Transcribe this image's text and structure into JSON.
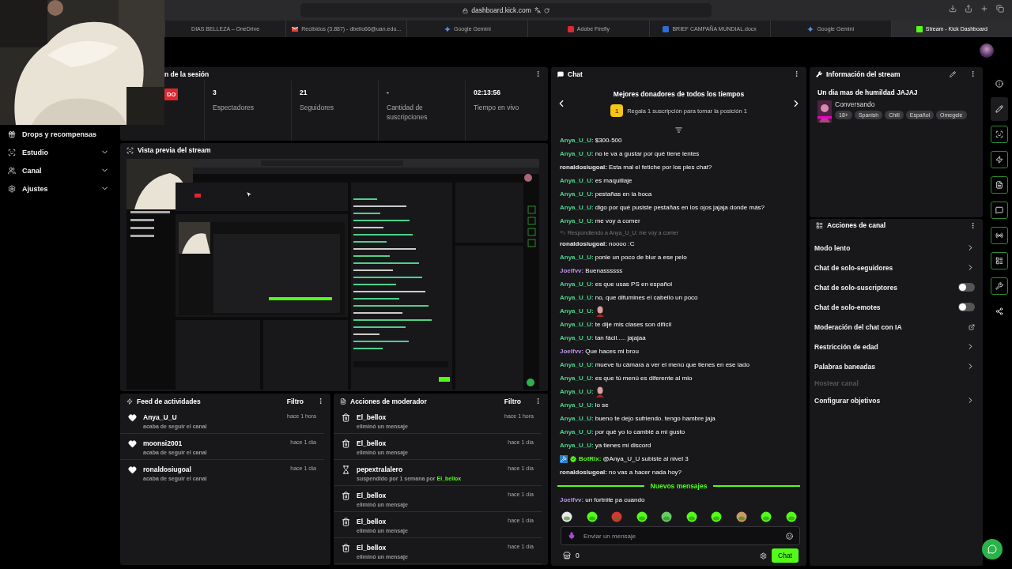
{
  "browser": {
    "address": "dashboard.kick.com",
    "tabs": [
      {
        "label": "DIAS BELLEZA – OneDrive",
        "kind": "none",
        "selected": false
      },
      {
        "label": "Recibidos (3.887) - dbello66@uan.edu...",
        "kind": "mail",
        "selected": false
      },
      {
        "label": "Google Gemini",
        "kind": "gemini",
        "selected": false
      },
      {
        "label": "Adobe Firefly",
        "kind": "firefly",
        "selected": false
      },
      {
        "label": "BRIEF CAMPAÑA MUNDIAL.docx",
        "kind": "word",
        "selected": false
      },
      {
        "label": "Google Gemini",
        "kind": "gemini",
        "selected": false
      },
      {
        "label": "Stream - Kick Dashboard",
        "kind": "kick",
        "selected": true
      }
    ]
  },
  "sidebar": {
    "items": [
      {
        "label": "Drops y recompensas",
        "kind": "drops",
        "expandable": false
      },
      {
        "label": "Estudio",
        "kind": "studio",
        "expandable": true
      },
      {
        "label": "Canal",
        "kind": "channel",
        "expandable": true
      },
      {
        "label": "Ajustes",
        "kind": "settings",
        "expandable": true
      }
    ]
  },
  "session": {
    "title": "n de la sesión",
    "live_badge": "DO",
    "stats": [
      {
        "value": "3",
        "label": "Espectadores"
      },
      {
        "value": "21",
        "label": "Seguidores"
      },
      {
        "value": "-",
        "label": "Cantidad de suscripciones"
      },
      {
        "value": "02:13:56",
        "label": "Tiempo en vivo"
      }
    ]
  },
  "preview": {
    "title": "Vista previa del stream"
  },
  "activity_feed": {
    "title": "Feed de actividades",
    "filter": "Filtro",
    "items": [
      {
        "user": "Anya_U_U",
        "action": "acaba de seguir el canal",
        "time": "hace 1 hora"
      },
      {
        "user": "moonsi2001",
        "action": "acaba de seguir el canal",
        "time": "hace 1 día"
      },
      {
        "user": "ronaldosiugoal",
        "action": "acaba de seguir el canal",
        "time": "hace 1 día"
      }
    ]
  },
  "mod_actions": {
    "title": "Acciones de moderador",
    "filter": "Filtro",
    "items": [
      {
        "kind": "delete",
        "user": "El_bellox",
        "action": "eliminó un mensaje",
        "time": "hace 1 hora"
      },
      {
        "kind": "delete",
        "user": "El_bellox",
        "action": "eliminó un mensaje",
        "time": "hace 1 día"
      },
      {
        "kind": "timeout",
        "user": "pepextralalero",
        "action": "suspendido por 1 semana por",
        "actor": "El_bellox",
        "time": "hace 1 día"
      },
      {
        "kind": "delete",
        "user": "El_bellox",
        "action": "eliminó un mensaje",
        "time": "hace 1 día"
      },
      {
        "kind": "delete",
        "user": "El_bellox",
        "action": "eliminó un mensaje",
        "time": "hace 1 día"
      },
      {
        "kind": "delete",
        "user": "El_bellox",
        "action": "eliminó un mensaje",
        "time": "hace 1 día"
      }
    ]
  },
  "chat": {
    "title": "Chat",
    "donors_title": "Mejores donadores de todos los tiempos",
    "donor_rank": "1",
    "donor_prompt": "Regala 1 suscripción para tomar la posición 1",
    "messages": [
      {
        "kind": "message",
        "user": "Anya_U_U:",
        "color": "#4fd18b",
        "text": "$300-500"
      },
      {
        "kind": "message",
        "user": "Anya_U_U:",
        "color": "#4fd18b",
        "text": "no le va a gustar por qué tiene lentes"
      },
      {
        "kind": "message",
        "user": "ronaldosiugoal:",
        "color": "#e8e8e8",
        "text": "Esta mal el fetiche por los pies chat?"
      },
      {
        "kind": "message",
        "user": "Anya_U_U:",
        "color": "#4fd18b",
        "text": "es maquillaje"
      },
      {
        "kind": "message",
        "user": "Anya_U_U:",
        "color": "#4fd18b",
        "text": "pestañas en la boca"
      },
      {
        "kind": "message",
        "user": "Anya_U_U:",
        "color": "#4fd18b",
        "text": "digo por qué pusiste pestañas en los ojos jajaja donde más?"
      },
      {
        "kind": "message",
        "user": "Anya_U_U:",
        "color": "#4fd18b",
        "text": "me voy a comer"
      },
      {
        "kind": "reply",
        "text": "Respondiendo a Anya_U_U: me voy a comer"
      },
      {
        "kind": "message",
        "user": "ronaldosiugoal:",
        "color": "#e8e8e8",
        "text": "noooo :C"
      },
      {
        "kind": "message",
        "user": "Anya_U_U:",
        "color": "#4fd18b",
        "text": "ponle un poco de blur a ese pelo"
      },
      {
        "kind": "message",
        "user": "Joelfvv:",
        "color": "#b894e6",
        "text": "Buenassssss"
      },
      {
        "kind": "message",
        "user": "Anya_U_U:",
        "color": "#4fd18b",
        "text": "es que usas PS en español"
      },
      {
        "kind": "message",
        "user": "Anya_U_U:",
        "color": "#4fd18b",
        "text": "no, que difumines el cabello un poco"
      },
      {
        "kind": "emote",
        "user": "Anya_U_U:",
        "color": "#4fd18b"
      },
      {
        "kind": "message",
        "user": "Anya_U_U:",
        "color": "#4fd18b",
        "text": "te dije mis clases son difícil"
      },
      {
        "kind": "message",
        "user": "Anya_U_U:",
        "color": "#4fd18b",
        "text": "tan fácil..... jajajaa"
      },
      {
        "kind": "message",
        "user": "Joelfvv:",
        "color": "#b894e6",
        "text": "Que haces mi brou"
      },
      {
        "kind": "message",
        "user": "Anya_U_U:",
        "color": "#4fd18b",
        "text": "mueve tu cámara a ver el menú que tienes en ese lado"
      },
      {
        "kind": "message",
        "user": "Anya_U_U:",
        "color": "#4fd18b",
        "text": "es que tú menú es diferente al mio"
      },
      {
        "kind": "emote",
        "user": "Anya_U_U:",
        "color": "#4fd18b"
      },
      {
        "kind": "message",
        "user": "Anya_U_U:",
        "color": "#4fd18b",
        "text": "lo se"
      },
      {
        "kind": "message",
        "user": "Anya_U_U:",
        "color": "#4fd18b",
        "text": "bueno te dejo sufriendo. tengo hambre jaja"
      },
      {
        "kind": "message",
        "user": "Anya_U_U:",
        "color": "#4fd18b",
        "text": "por qué yo lo cambié a mi gusto"
      },
      {
        "kind": "message",
        "user": "Anya_U_U:",
        "color": "#4fd18b",
        "text": "ya tienes mi discord"
      },
      {
        "kind": "bot",
        "user": "BotRix:",
        "color": "#53fc18",
        "text": "@Anya_U_U subiste al nivel 3"
      },
      {
        "kind": "message",
        "user": "ronaldosiugoal:",
        "color": "#e8e8e8",
        "text": "no vas a hacer nada hoy?"
      },
      {
        "kind": "divider",
        "text": "Nuevos mensajes"
      },
      {
        "kind": "message",
        "user": "Joelfvv:",
        "color": "#b894e6",
        "text": "un fortnite pa cuando"
      }
    ],
    "placeholder": "Enviar un mensaje",
    "points": "0",
    "send": "Chat"
  },
  "stream_info": {
    "title": "Información del stream",
    "stream_title": "Un dia mas de humildad JAJAJ",
    "category": "Conversando",
    "tags": [
      "18+",
      "Spanish",
      "Chill",
      "Español",
      "Omegele"
    ]
  },
  "channel_actions": {
    "title": "Acciones de canal",
    "items": [
      {
        "label": "Modo lento",
        "kind": "arrow",
        "disabled": false
      },
      {
        "label": "Chat de solo-seguidores",
        "kind": "arrow",
        "disabled": false
      },
      {
        "label": "Chat de solo-suscriptores",
        "kind": "toggle",
        "on": false,
        "disabled": false
      },
      {
        "label": "Chat de solo-emotes",
        "kind": "toggle",
        "on": false,
        "disabled": false
      },
      {
        "label": "Moderación del chat con IA",
        "kind": "external",
        "disabled": false
      },
      {
        "label": "Restricción de edad",
        "kind": "arrow",
        "disabled": false
      },
      {
        "label": "Palabras baneadas",
        "kind": "arrow",
        "disabled": false
      },
      {
        "label": "Hostear canal",
        "kind": "plain",
        "disabled": true
      },
      {
        "label": "Configurar objetivos",
        "kind": "arrow",
        "disabled": false
      }
    ]
  },
  "rail": [
    {
      "kind": "info",
      "active": false
    },
    {
      "kind": "pencil",
      "active": false
    },
    {
      "kind": "preview",
      "active": true
    },
    {
      "kind": "bolt",
      "active": true
    },
    {
      "kind": "doc",
      "active": true
    },
    {
      "kind": "chat",
      "active": true
    },
    {
      "kind": "broadcast",
      "active": true
    },
    {
      "kind": "actions",
      "active": true
    },
    {
      "kind": "wrench",
      "active": true
    },
    {
      "kind": "nodes",
      "active": false
    }
  ]
}
